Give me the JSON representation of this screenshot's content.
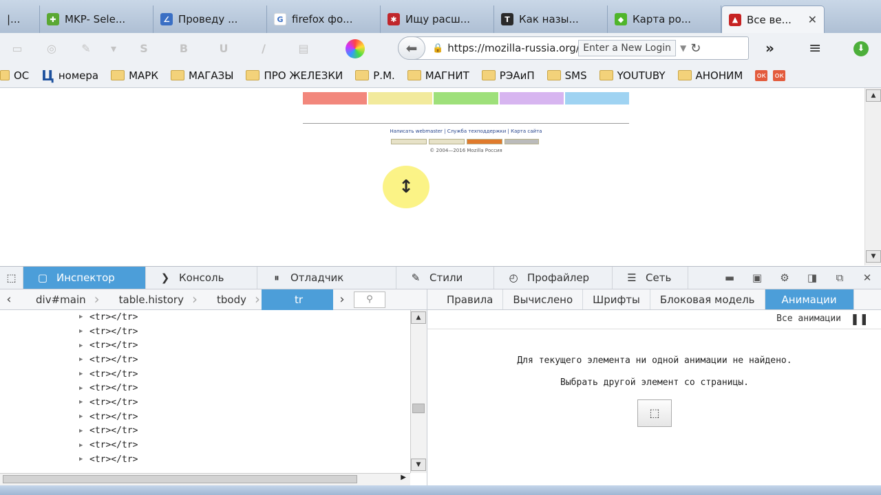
{
  "tabs": [
    {
      "title": "|...",
      "fav": "",
      "color": "#6d8fb9"
    },
    {
      "title": "MKP- Sele...",
      "fav": "✚",
      "color": "#5aa832"
    },
    {
      "title": "Проведу ...",
      "fav": "∠",
      "color": "#3a6fc4"
    },
    {
      "title": "firefox фо...",
      "fav": "G",
      "color": "#ffffff"
    },
    {
      "title": "Ищу расш...",
      "fav": "✱",
      "color": "#c0262b"
    },
    {
      "title": "Как назы...",
      "fav": "T",
      "color": "#2a2a2a"
    },
    {
      "title": "Карта ро...",
      "fav": "◆",
      "color": "#4fb52a"
    },
    {
      "title": "Все ве...",
      "fav": "▲",
      "color": "#c62222"
    }
  ],
  "tab_close": "✕",
  "toolbar": {
    "ghost_icons": [
      "▭",
      "◎",
      "✎",
      "▾",
      "S",
      "B",
      "U",
      "/",
      "▤"
    ],
    "back": "⬅",
    "url": "https://mozilla-russia.org/forum/viewtopic.php",
    "login_button": "Enter a New Login",
    "reload": "↻",
    "more": "»",
    "menu": "≡",
    "download": "⬇"
  },
  "bookmarks": [
    {
      "label": "ОС",
      "icon": "folder"
    },
    {
      "label": "номера",
      "icon": "ts"
    },
    {
      "label": "МАРК",
      "icon": "folder"
    },
    {
      "label": "МАГАЗЫ",
      "icon": "folder"
    },
    {
      "label": "ПРО ЖЕЛЕЗКИ",
      "icon": "folder"
    },
    {
      "label": "Р.М.",
      "icon": "folder"
    },
    {
      "label": "МАГНИТ",
      "icon": "folder"
    },
    {
      "label": "РЭАиП",
      "icon": "folder"
    },
    {
      "label": "SMS",
      "icon": "folder"
    },
    {
      "label": "YOUTUBY",
      "icon": "folder"
    },
    {
      "label": "АНОНИМ",
      "icon": "folder"
    }
  ],
  "page": {
    "tab_colors": [
      "#f2877c",
      "#f2ea9c",
      "#9ee07a",
      "#d7b5f0",
      "#9fd3f2"
    ],
    "footer": "Написать webmaster | Служба техподдержки | Карта сайта",
    "copyright": "© 2004—2016 Mozilla Россия",
    "cursor": "↕"
  },
  "devtools": {
    "tools": [
      {
        "label": "Инспектор",
        "icon": "▢"
      },
      {
        "label": "Консоль",
        "icon": "❯"
      },
      {
        "label": "Отладчик",
        "icon": "⏸"
      },
      {
        "label": "Стили",
        "icon": "✎"
      },
      {
        "label": "Профайлер",
        "icon": "◴"
      },
      {
        "label": "Сеть",
        "icon": "☰"
      }
    ],
    "breadcrumbs": [
      "div#main",
      "table.history",
      "tbody",
      "tr"
    ],
    "search_icon": "⚲",
    "markup_rows": [
      "<tr></tr>",
      "<tr></tr>",
      "<tr></tr>",
      "<tr></tr>",
      "<tr></tr>",
      "<tr></tr>",
      "<tr></tr>",
      "<tr></tr>",
      "<tr></tr>",
      "<tr></tr>",
      "<tr></tr>"
    ],
    "side_tabs": [
      "Правила",
      "Вычислено",
      "Шрифты",
      "Блоковая модель",
      "Анимации"
    ],
    "animations": {
      "all_label": "Все анимации",
      "message": "Для текущего элемента ни одной анимации не найдено.",
      "pick_hint": "Выбрать другой элемент со страницы."
    }
  }
}
